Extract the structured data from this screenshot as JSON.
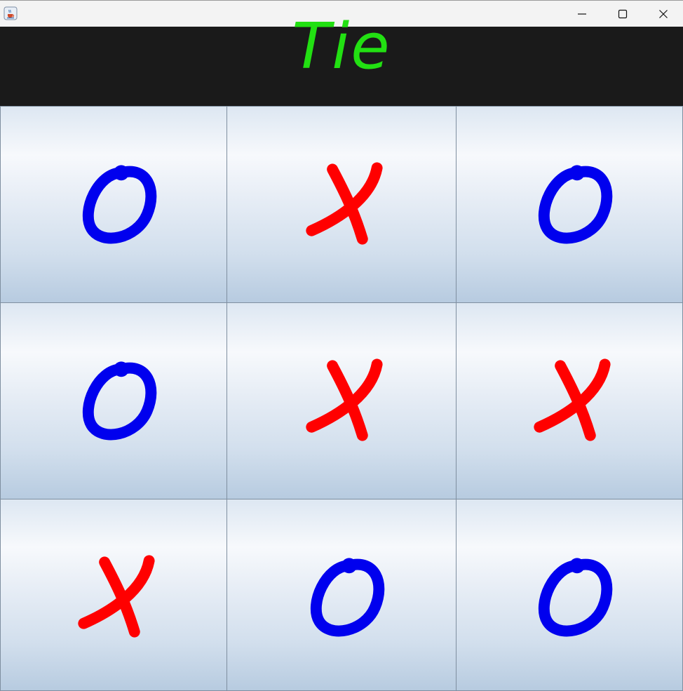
{
  "window": {
    "icon": "java-cup-icon",
    "controls": [
      "minimize-icon",
      "maximize-icon",
      "close-icon"
    ]
  },
  "header": {
    "status_text": "Tie",
    "status_color": "#22e012",
    "background": "#1a1a1a"
  },
  "board": {
    "cells": [
      {
        "row": 1,
        "col": 1,
        "mark": "O"
      },
      {
        "row": 1,
        "col": 2,
        "mark": "X"
      },
      {
        "row": 1,
        "col": 3,
        "mark": "O"
      },
      {
        "row": 2,
        "col": 1,
        "mark": "O"
      },
      {
        "row": 2,
        "col": 2,
        "mark": "X"
      },
      {
        "row": 2,
        "col": 3,
        "mark": "X"
      },
      {
        "row": 3,
        "col": 1,
        "mark": "X"
      },
      {
        "row": 3,
        "col": 2,
        "mark": "O"
      },
      {
        "row": 3,
        "col": 3,
        "mark": "O"
      }
    ],
    "colors": {
      "X": "#ff0000",
      "O": "#0000ee"
    }
  }
}
